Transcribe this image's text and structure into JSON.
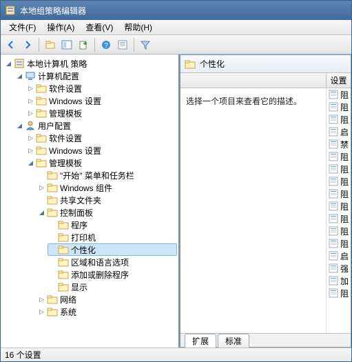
{
  "window": {
    "title": "本地组策略编辑器"
  },
  "menu": {
    "file": "文件(F)",
    "action": "操作(A)",
    "view": "查看(V)",
    "help": "帮助(H)"
  },
  "toolbar_icons": [
    "back",
    "forward",
    "up",
    "views",
    "export",
    "help",
    "properties",
    "filter"
  ],
  "tree": {
    "root": {
      "label": "本地计算机 策略",
      "expanded": true,
      "icon": "policy"
    },
    "computer": {
      "label": "计算机配置",
      "expanded": true,
      "icon": "computer"
    },
    "computer_software": {
      "label": "软件设置",
      "icon": "folder"
    },
    "computer_windows": {
      "label": "Windows 设置",
      "icon": "folder"
    },
    "computer_admin": {
      "label": "管理模板",
      "icon": "folder"
    },
    "user": {
      "label": "用户配置",
      "expanded": true,
      "icon": "user"
    },
    "user_software": {
      "label": "软件设置",
      "icon": "folder"
    },
    "user_windows": {
      "label": "Windows 设置",
      "icon": "folder"
    },
    "user_admin": {
      "label": "管理模板",
      "expanded": true,
      "icon": "folder"
    },
    "startmenu": {
      "label": "\"开始\" 菜单和任务栏",
      "icon": "folder"
    },
    "wincomp": {
      "label": "Windows 组件",
      "icon": "folder"
    },
    "shared": {
      "label": "共享文件夹",
      "icon": "folder"
    },
    "cpanel": {
      "label": "控制面板",
      "expanded": true,
      "icon": "folder"
    },
    "programs": {
      "label": "程序",
      "icon": "folder"
    },
    "printers": {
      "label": "打印机",
      "icon": "folder"
    },
    "personalization": {
      "label": "个性化",
      "icon": "folder",
      "selected": true
    },
    "region": {
      "label": "区域和语言选项",
      "icon": "folder"
    },
    "addremove": {
      "label": "添加或删除程序",
      "icon": "folder"
    },
    "display": {
      "label": "显示",
      "icon": "folder"
    },
    "network": {
      "label": "网络",
      "icon": "folder"
    },
    "system": {
      "label": "系统",
      "icon": "folder"
    }
  },
  "content": {
    "title": "个性化",
    "description": "选择一个项目来查看它的描述。",
    "column_header": "设置",
    "items": [
      "阻",
      "阻",
      "阻",
      "启",
      "禁",
      "阻",
      "阻",
      "阻",
      "阻",
      "阻",
      "阻",
      "阻",
      "阻",
      "启",
      "强",
      "加",
      "阻"
    ]
  },
  "tabs": {
    "extended": "扩展",
    "standard": "标准",
    "active": "extended"
  },
  "status": {
    "text": "16 个设置"
  }
}
